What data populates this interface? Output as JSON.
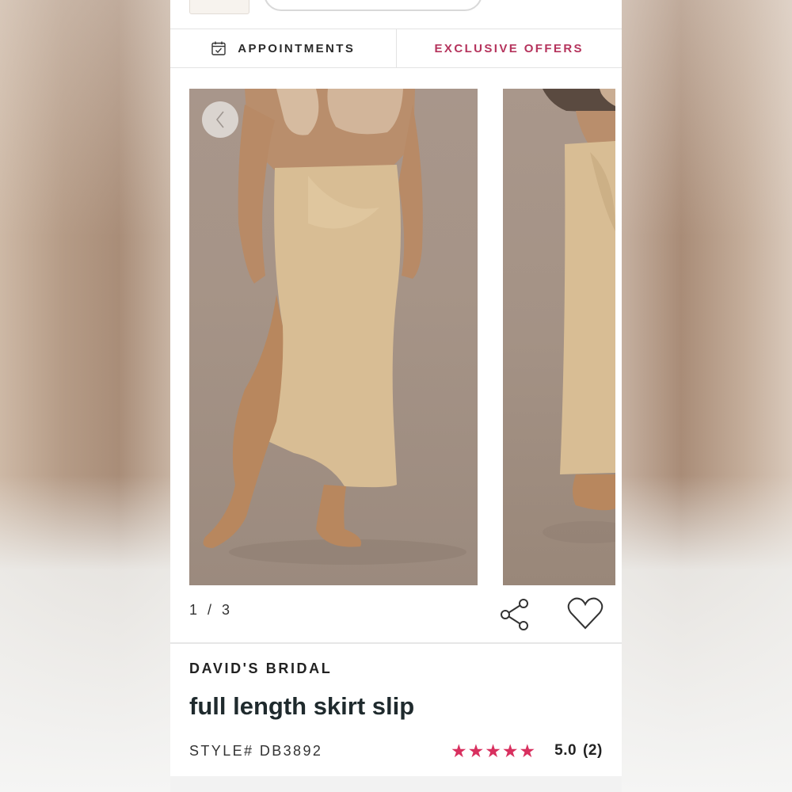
{
  "tabs": {
    "appointments": "APPOINTMENTS",
    "exclusive_offers": "EXCLUSIVE OFFERS"
  },
  "gallery": {
    "counter": "1 / 3",
    "current_index": 1,
    "total": 3
  },
  "product": {
    "brand": "DAVID'S BRIDAL",
    "title": "full length skirt slip",
    "style": "STYLE# DB3892",
    "rating_value": "5.0",
    "review_count": "(2)",
    "stars": 5
  },
  "colors": {
    "accent": "#b5335c",
    "star": "#d8305f",
    "text": "#222222"
  },
  "icons": [
    "calendar-icon",
    "chevron-left-icon",
    "share-icon",
    "heart-icon",
    "star-icon"
  ]
}
